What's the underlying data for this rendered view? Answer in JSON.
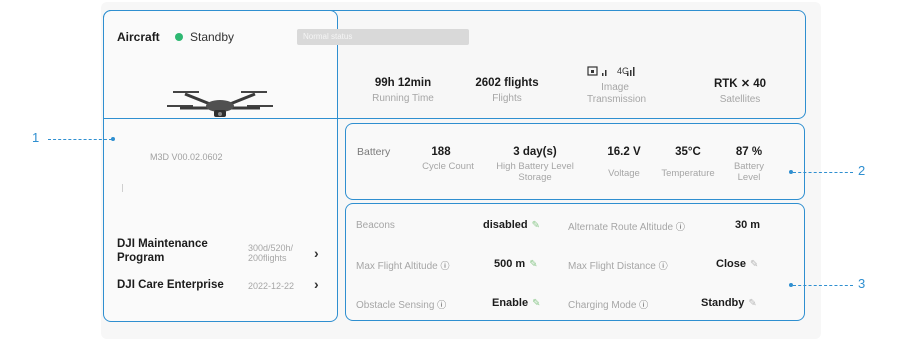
{
  "header": {
    "title": "Aircraft",
    "status": "Standby",
    "normal_status": "Normal status"
  },
  "colors": {
    "accent": "#2f8fd0",
    "status_ok": "#2eb872",
    "edit_icon": "#8ec98e"
  },
  "aircraft": {
    "firmware": "M3D V00.02.0602"
  },
  "programs": [
    {
      "name": "DJI Maintenance Program",
      "meta_line1": "300d/520h/",
      "meta_line2": "200flights"
    },
    {
      "name": "DJI Care Enterprise",
      "meta_line1": "2022-12-22",
      "meta_line2": ""
    }
  ],
  "stats": [
    {
      "value": "99h 12min",
      "label": "Running Time"
    },
    {
      "value": "2602 flights",
      "label": "Flights"
    },
    {
      "value": "4G",
      "label": "Image Transmission",
      "icon": "signal-icon"
    },
    {
      "value": "RTK",
      "value2": "40",
      "label": "Satellites",
      "icon": "satellite-icon"
    }
  ],
  "battery": {
    "label": "Battery",
    "items": [
      {
        "value": "188",
        "label": "Cycle Count"
      },
      {
        "value": "3 day(s)",
        "label": "High Battery Level Storage"
      },
      {
        "value": "16.2 V",
        "label": "Voltage"
      },
      {
        "value": "35°C",
        "label": "Temperature"
      },
      {
        "value": "87 %",
        "label": "Battery Level"
      }
    ]
  },
  "settings": [
    {
      "label": "Beacons",
      "value": "disabled",
      "info": false,
      "edit": "green"
    },
    {
      "label": "Alternate Route Altitude",
      "value": "30 m",
      "info": true,
      "edit": "none"
    },
    {
      "label": "Max Flight Altitude",
      "value": "500 m",
      "info": true,
      "edit": "green"
    },
    {
      "label": "Max Flight Distance",
      "value": "Close",
      "info": true,
      "edit": "gray"
    },
    {
      "label": "Obstacle Sensing",
      "value": "Enable",
      "info": true,
      "edit": "green"
    },
    {
      "label": "Charging Mode",
      "value": "Standby",
      "info": true,
      "edit": "gray"
    }
  ],
  "callouts": [
    "1",
    "2",
    "3"
  ]
}
